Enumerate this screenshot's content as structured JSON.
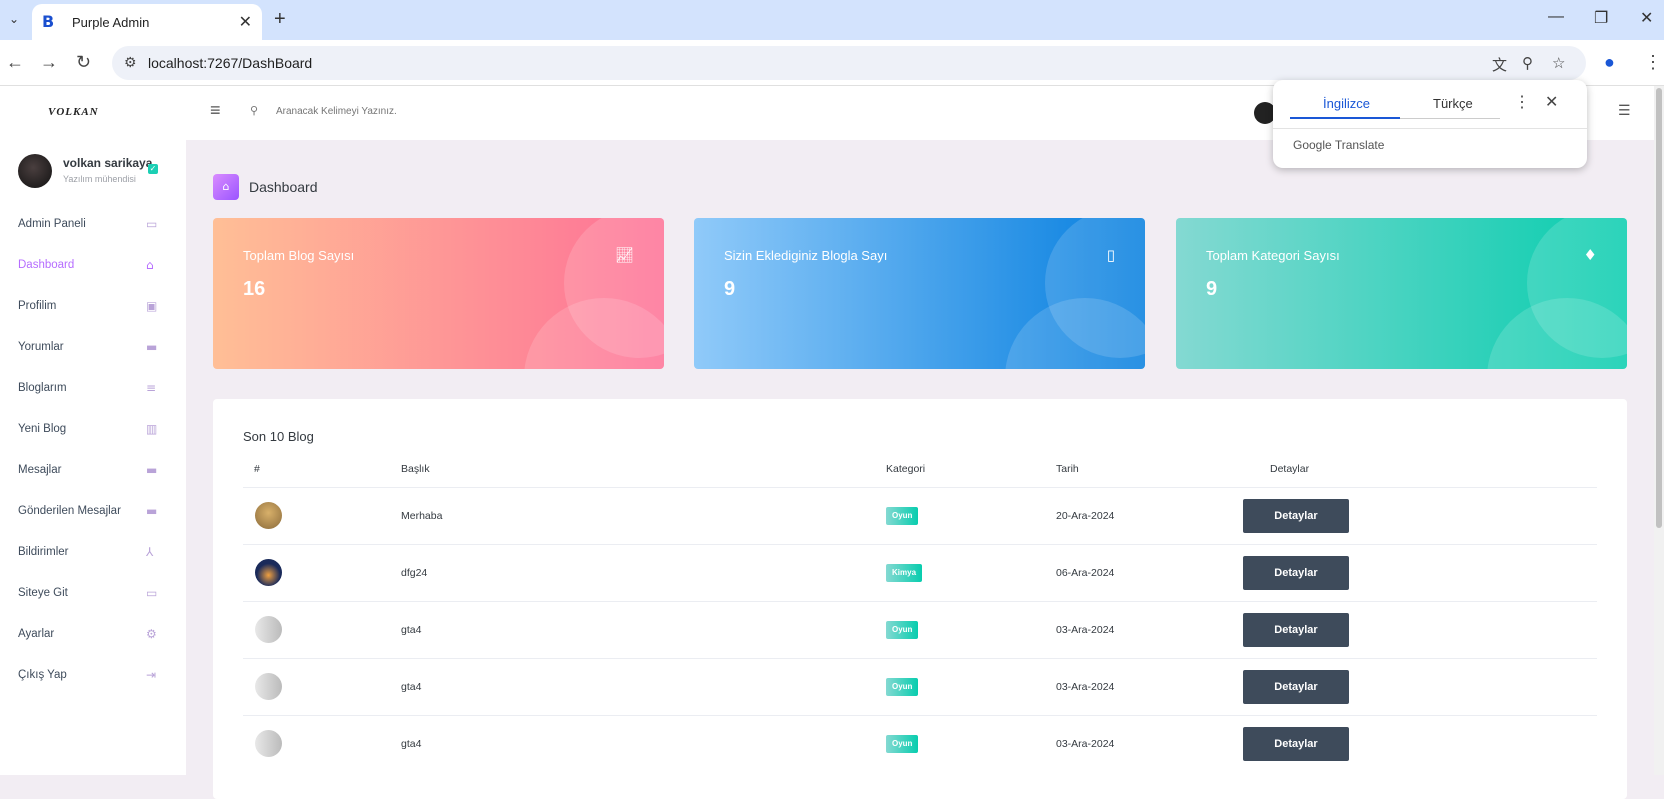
{
  "browser": {
    "tab_title": "Purple Admin",
    "url": "localhost:7267/DashBoard"
  },
  "translate": {
    "lang_from": "İngilizce",
    "lang_to": "Türkçe",
    "brand": "Google Translate"
  },
  "sidebar": {
    "logo": "VOLKAN",
    "user_name": "volkan sarikaya",
    "user_role": "Yazılım mühendisi",
    "items": [
      {
        "label": "Admin Paneli",
        "icon": "chat-icon"
      },
      {
        "label": "Dashboard",
        "icon": "home-icon"
      },
      {
        "label": "Profilim",
        "icon": "contact-icon"
      },
      {
        "label": "Yorumlar",
        "icon": "comment-icon"
      },
      {
        "label": "Bloglarım",
        "icon": "list-icon"
      },
      {
        "label": "Yeni Blog",
        "icon": "chart-icon"
      },
      {
        "label": "Mesajlar",
        "icon": "message-icon"
      },
      {
        "label": "Gönderilen Mesajlar",
        "icon": "message-icon"
      },
      {
        "label": "Bildirimler",
        "icon": "bell-icon"
      },
      {
        "label": "Siteye Git",
        "icon": "car-icon"
      },
      {
        "label": "Ayarlar",
        "icon": "gear-icon"
      },
      {
        "label": "Çıkış Yap",
        "icon": "logout-icon"
      }
    ],
    "active_index": 1
  },
  "topbar": {
    "search_placeholder": "Aranacak Kelimeyi Yazınız."
  },
  "page": {
    "title": "Dashboard"
  },
  "stats": [
    {
      "title": "Toplam Blog Sayısı",
      "value": "16",
      "icon": "trend-chart-icon"
    },
    {
      "title": "Sizin Eklediginiz Blogla Sayı",
      "value": "9",
      "icon": "bookmark-icon"
    },
    {
      "title": "Toplam Kategori Sayısı",
      "value": "9",
      "icon": "diamond-icon"
    }
  ],
  "table": {
    "title": "Son 10 Blog",
    "headers": [
      "#",
      "Başlık",
      "Kategori",
      "Tarih",
      "Detaylar"
    ],
    "rows": [
      {
        "title": "Merhaba",
        "category": "Oyun",
        "date": "20-Ara-2024",
        "action": "Detaylar"
      },
      {
        "title": "dfg24",
        "category": "Kimya",
        "date": "06-Ara-2024",
        "action": "Detaylar"
      },
      {
        "title": "gta4",
        "category": "Oyun",
        "date": "03-Ara-2024",
        "action": "Detaylar"
      },
      {
        "title": "gta4",
        "category": "Oyun",
        "date": "03-Ara-2024",
        "action": "Detaylar"
      },
      {
        "title": "gta4",
        "category": "Oyun",
        "date": "03-Ara-2024",
        "action": "Detaylar"
      }
    ]
  },
  "colors": {
    "accent": "#b66dff",
    "dark_button": "#3e4b5b",
    "badge": "#1bcfb4"
  }
}
